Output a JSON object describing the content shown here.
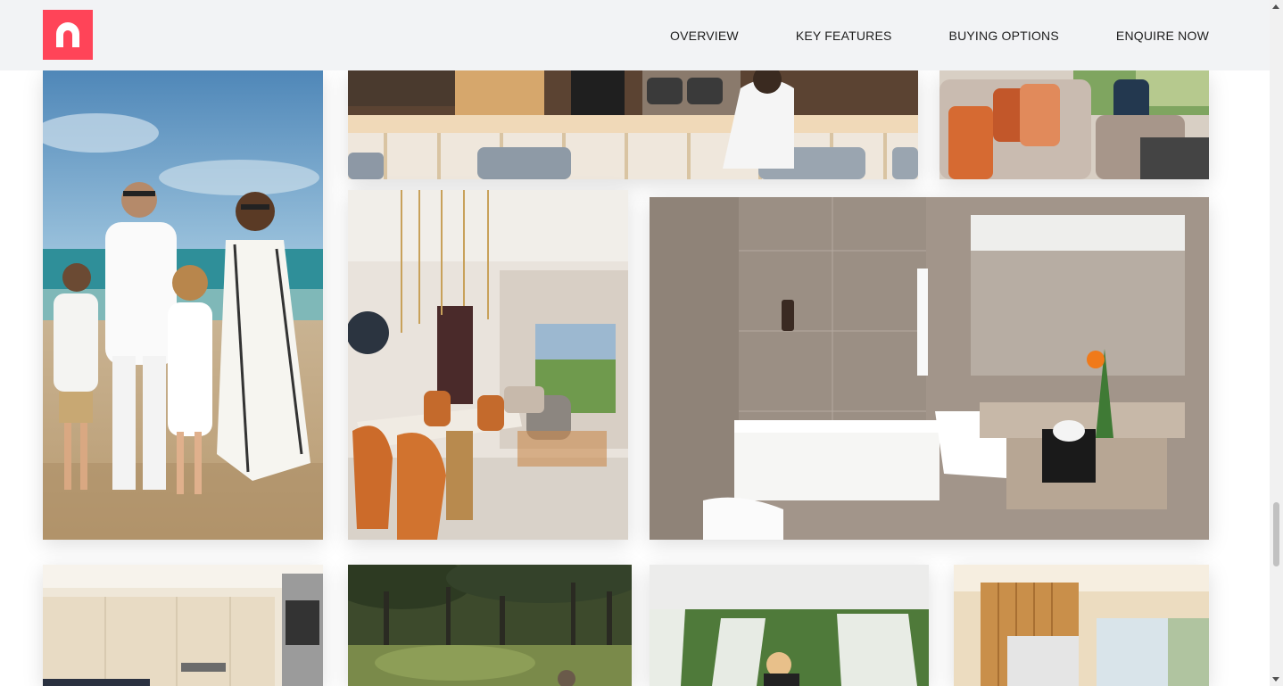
{
  "header": {
    "logo_icon": "brand-n-logo-icon",
    "logo_color": "#ff4458",
    "nav": [
      {
        "label": "OVERVIEW"
      },
      {
        "label": "KEY FEATURES"
      },
      {
        "label": "BUYING OPTIONS"
      },
      {
        "label": "ENQUIRE NOW"
      }
    ]
  },
  "gallery": {
    "photos": [
      {
        "subject": "family walking on beach"
      },
      {
        "subject": "bar counter with bartender"
      },
      {
        "subject": "lounge with orange cushions"
      },
      {
        "subject": "dining area with pendant lights"
      },
      {
        "subject": "bathroom with bathtub and sink"
      },
      {
        "subject": "kitchen"
      },
      {
        "subject": "pine forest"
      },
      {
        "subject": "outdoor massage cabana"
      },
      {
        "subject": "bedroom"
      }
    ]
  }
}
